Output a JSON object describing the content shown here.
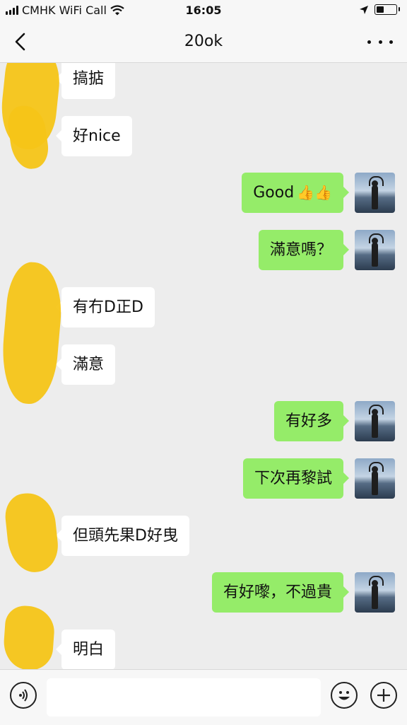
{
  "status_bar": {
    "carrier": "CMHK WiFi Call",
    "time": "16:05"
  },
  "header": {
    "title": "20ok"
  },
  "messages": [
    {
      "side": "left",
      "text": "搞掂"
    },
    {
      "side": "left",
      "text": "好nice"
    },
    {
      "side": "right",
      "text": "Good",
      "emoji": "👍👍"
    },
    {
      "side": "right",
      "text": "滿意嗎？"
    },
    {
      "side": "left",
      "text": "有冇D正D"
    },
    {
      "side": "left",
      "text": "滿意"
    },
    {
      "side": "right",
      "text": "有好多"
    },
    {
      "side": "right",
      "text": "下次再黎試"
    },
    {
      "side": "left",
      "text": "但頭先果D好曳"
    },
    {
      "side": "right",
      "text": "有好嚟，不過貴"
    },
    {
      "side": "left",
      "text": "明白"
    }
  ],
  "input_bar": {
    "value": "",
    "icons": [
      "voice-icon",
      "emoji-icon",
      "plus-icon"
    ]
  },
  "colors": {
    "background": "#ededed",
    "bubble_self": "#95ec69",
    "bubble_other": "#ffffff",
    "redaction": "#f5c518"
  }
}
